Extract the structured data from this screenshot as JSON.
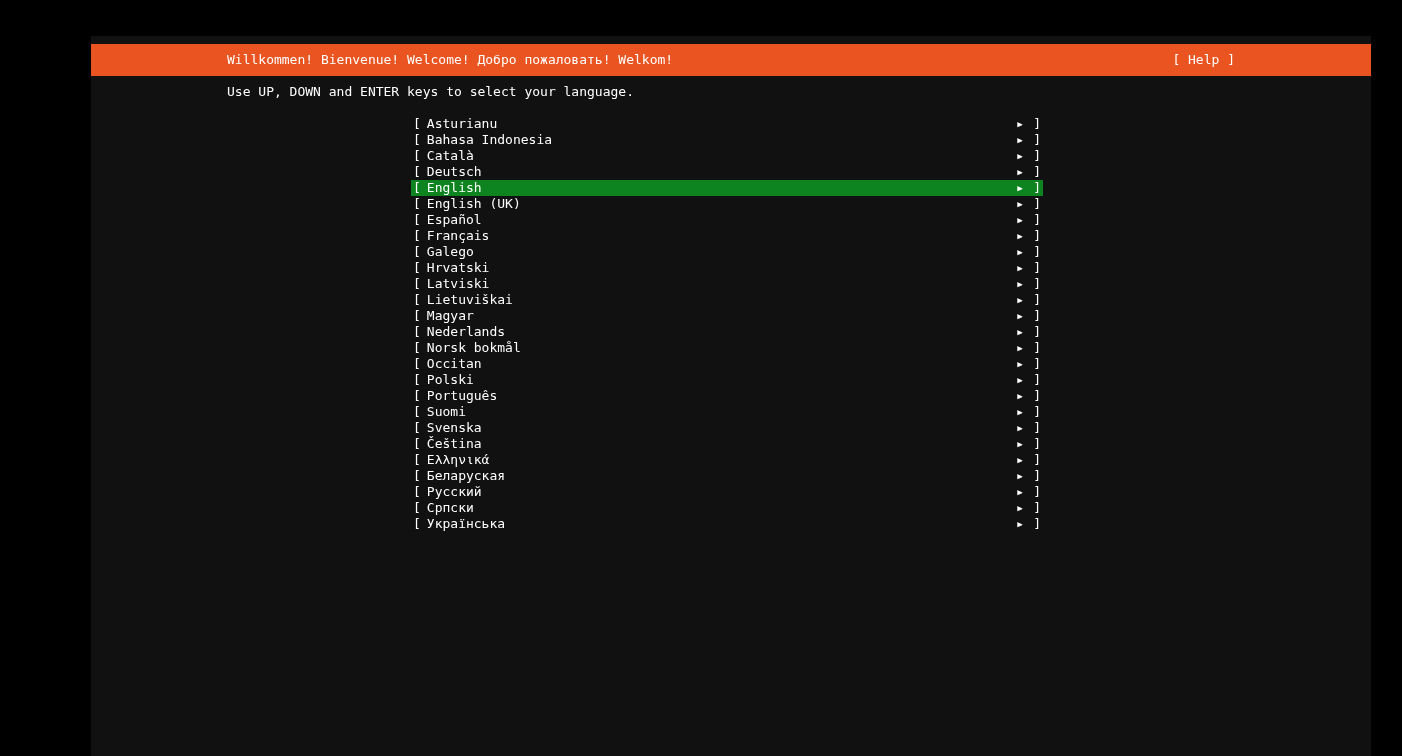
{
  "header": {
    "title": "Willkommen! Bienvenue! Welcome! Добро пожаловать! Welkom!",
    "help": "[ Help ]"
  },
  "instructions": "Use UP, DOWN and ENTER keys to select your language.",
  "languages": [
    {
      "open": "[",
      "label": "Asturianu",
      "arrow": "▶",
      "close": "]",
      "selected": false
    },
    {
      "open": "[",
      "label": "Bahasa Indonesia",
      "arrow": "▶",
      "close": "]",
      "selected": false
    },
    {
      "open": "[",
      "label": "Català",
      "arrow": "▶",
      "close": "]",
      "selected": false
    },
    {
      "open": "[",
      "label": "Deutsch",
      "arrow": "▶",
      "close": "]",
      "selected": false
    },
    {
      "open": "[",
      "label": "English",
      "arrow": "▶",
      "close": "]",
      "selected": true
    },
    {
      "open": "[",
      "label": "English (UK)",
      "arrow": "▶",
      "close": "]",
      "selected": false
    },
    {
      "open": "[",
      "label": "Español",
      "arrow": "▶",
      "close": "]",
      "selected": false
    },
    {
      "open": "[",
      "label": "Français",
      "arrow": "▶",
      "close": "]",
      "selected": false
    },
    {
      "open": "[",
      "label": "Galego",
      "arrow": "▶",
      "close": "]",
      "selected": false
    },
    {
      "open": "[",
      "label": "Hrvatski",
      "arrow": "▶",
      "close": "]",
      "selected": false
    },
    {
      "open": "[",
      "label": "Latviski",
      "arrow": "▶",
      "close": "]",
      "selected": false
    },
    {
      "open": "[",
      "label": "Lietuviškai",
      "arrow": "▶",
      "close": "]",
      "selected": false
    },
    {
      "open": "[",
      "label": "Magyar",
      "arrow": "▶",
      "close": "]",
      "selected": false
    },
    {
      "open": "[",
      "label": "Nederlands",
      "arrow": "▶",
      "close": "]",
      "selected": false
    },
    {
      "open": "[",
      "label": "Norsk bokmål",
      "arrow": "▶",
      "close": "]",
      "selected": false
    },
    {
      "open": "[",
      "label": "Occitan",
      "arrow": "▶",
      "close": "]",
      "selected": false
    },
    {
      "open": "[",
      "label": "Polski",
      "arrow": "▶",
      "close": "]",
      "selected": false
    },
    {
      "open": "[",
      "label": "Português",
      "arrow": "▶",
      "close": "]",
      "selected": false
    },
    {
      "open": "[",
      "label": "Suomi",
      "arrow": "▶",
      "close": "]",
      "selected": false
    },
    {
      "open": "[",
      "label": "Svenska",
      "arrow": "▶",
      "close": "]",
      "selected": false
    },
    {
      "open": "[",
      "label": "Čeština",
      "arrow": "▶",
      "close": "]",
      "selected": false
    },
    {
      "open": "[",
      "label": "Ελληνικά",
      "arrow": "▶",
      "close": "]",
      "selected": false
    },
    {
      "open": "[",
      "label": "Беларуская",
      "arrow": "▶",
      "close": "]",
      "selected": false
    },
    {
      "open": "[",
      "label": "Русский",
      "arrow": "▶",
      "close": "]",
      "selected": false
    },
    {
      "open": "[",
      "label": "Српски",
      "arrow": "▶",
      "close": "]",
      "selected": false
    },
    {
      "open": "[",
      "label": "Українська",
      "arrow": "▶",
      "close": "]",
      "selected": false
    }
  ]
}
